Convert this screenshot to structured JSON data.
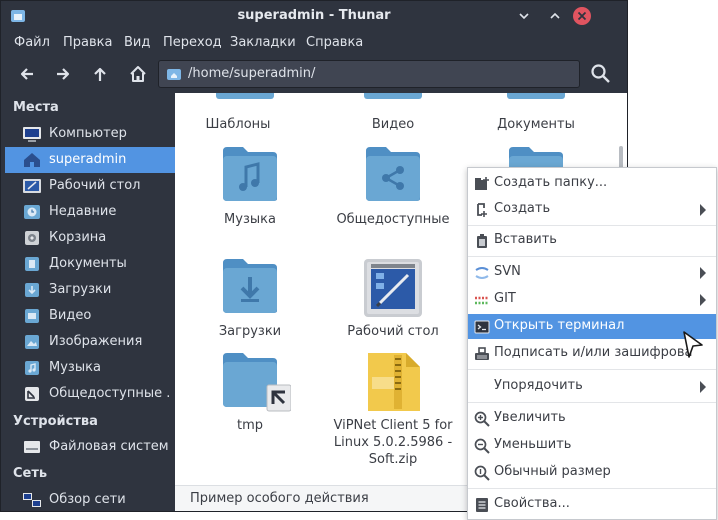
{
  "window": {
    "title": "superadmin - Thunar",
    "colors": {
      "chrome": "#2f343f",
      "accent": "#5294e2",
      "folder": "#6aa7d3",
      "close": "#e05460"
    }
  },
  "menu": [
    "Файл",
    "Правка",
    "Вид",
    "Переход",
    "Закладки",
    "Справка"
  ],
  "toolbar": {
    "back_icon": "arrow-left-icon",
    "forward_icon": "arrow-right-icon",
    "up_icon": "arrow-up-icon",
    "home_icon": "home-icon",
    "path": "/home/superadmin/",
    "search_icon": "search-icon"
  },
  "sidebar": {
    "places_heading": "Места",
    "places": [
      {
        "label": "Компьютер",
        "icon": "computer-icon"
      },
      {
        "label": "superadmin",
        "icon": "home-icon",
        "active": true
      },
      {
        "label": "Рабочий стол",
        "icon": "desktop-icon"
      },
      {
        "label": "Недавние",
        "icon": "recent-icon"
      },
      {
        "label": "Корзина",
        "icon": "trash-icon"
      },
      {
        "label": "Документы",
        "icon": "documents-folder-icon"
      },
      {
        "label": "Загрузки",
        "icon": "downloads-folder-icon"
      },
      {
        "label": "Видео",
        "icon": "videos-folder-icon"
      },
      {
        "label": "Изображения",
        "icon": "pictures-folder-icon"
      },
      {
        "label": "Музыка",
        "icon": "music-folder-icon"
      },
      {
        "label": "Общедоступные ...",
        "icon": "public-folder-icon"
      }
    ],
    "devices_heading": "Устройства",
    "devices": [
      {
        "label": "Файловая система",
        "icon": "drive-icon"
      }
    ],
    "network_heading": "Сеть",
    "network": [
      {
        "label": "Обзор сети",
        "icon": "network-icon"
      }
    ]
  },
  "files": [
    {
      "label": "Шаблоны",
      "icon": "templates-folder-icon"
    },
    {
      "label": "Видео",
      "icon": "videos-folder-icon"
    },
    {
      "label": "Документы",
      "icon": "documents-folder-icon"
    },
    {
      "label": "Музыка",
      "icon": "music-folder-icon"
    },
    {
      "label": "Общедоступные",
      "icon": "public-folder-icon"
    },
    {
      "label": "",
      "icon": "folder-icon"
    },
    {
      "label": "Загрузки",
      "icon": "downloads-folder-icon"
    },
    {
      "label": "Рабочий стол",
      "icon": "desktop-icon"
    },
    {
      "label": "tmp",
      "icon": "folder-symlink-icon"
    },
    {
      "label": "ViPNet Client 5 for Linux 5.0.2.5986 - Soft.zip",
      "label_lines": [
        "ViPNet Client 5 for",
        "Linux 5.0.2.5986 -",
        "Soft.zip"
      ],
      "icon": "zip-archive-icon"
    }
  ],
  "statusbar": {
    "text": "Пример особого действия"
  },
  "context_menu": [
    {
      "label": "Создать папку...",
      "icon": "new-folder-icon"
    },
    {
      "label": "Создать",
      "icon": "new-file-icon",
      "submenu": true
    },
    {
      "label": "Вставить",
      "icon": "paste-icon"
    },
    {
      "label": "SVN",
      "icon": "svn-icon",
      "submenu": true
    },
    {
      "label": "GIT",
      "icon": "git-icon",
      "submenu": true
    },
    {
      "label": "Открыть терминал",
      "icon": "terminal-icon",
      "active": true
    },
    {
      "label": "Подписать и/или зашифрова",
      "icon": "sign-encrypt-icon"
    },
    {
      "label": "Упорядочить",
      "icon": "",
      "submenu": true
    },
    {
      "label": "Увеличить",
      "icon": "zoom-in-icon"
    },
    {
      "label": "Уменьшить",
      "icon": "zoom-out-icon"
    },
    {
      "label": "Обычный размер",
      "icon": "zoom-original-icon"
    },
    {
      "label": "Свойства...",
      "icon": "properties-icon"
    }
  ]
}
